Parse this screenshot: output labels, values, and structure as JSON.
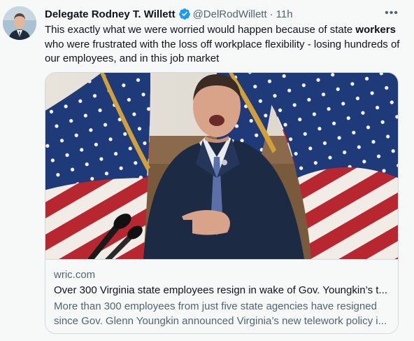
{
  "tweet": {
    "author_name": "Delegate Rodney T. Willett",
    "handle": "@DelRodWillett",
    "separator": "·",
    "time": "11h",
    "more_label": "•••",
    "text_before": "This exactly what we were worried would happen because of state ",
    "text_bold": "workers",
    "text_after": " who were frustrated with the loss off workplace flexibility - losing hundreds of our employees, and in this job market"
  },
  "card": {
    "domain": "wric.com",
    "title": "Over 300 Virginia state employees resign in wake of Gov. Youngkin’s t...",
    "description": "More than 300 employees from just five state agencies have resigned since Gov. Glenn Youngkin announced Virginia’s new telework policy i..."
  },
  "colors": {
    "text": "#0f1419",
    "secondary": "#536471",
    "verified_blue": "#1d9bf0",
    "border": "#cfd9de",
    "background": "#f7f9f9"
  },
  "icons": {
    "verified": "verified-badge-icon",
    "more": "more-options-icon"
  }
}
